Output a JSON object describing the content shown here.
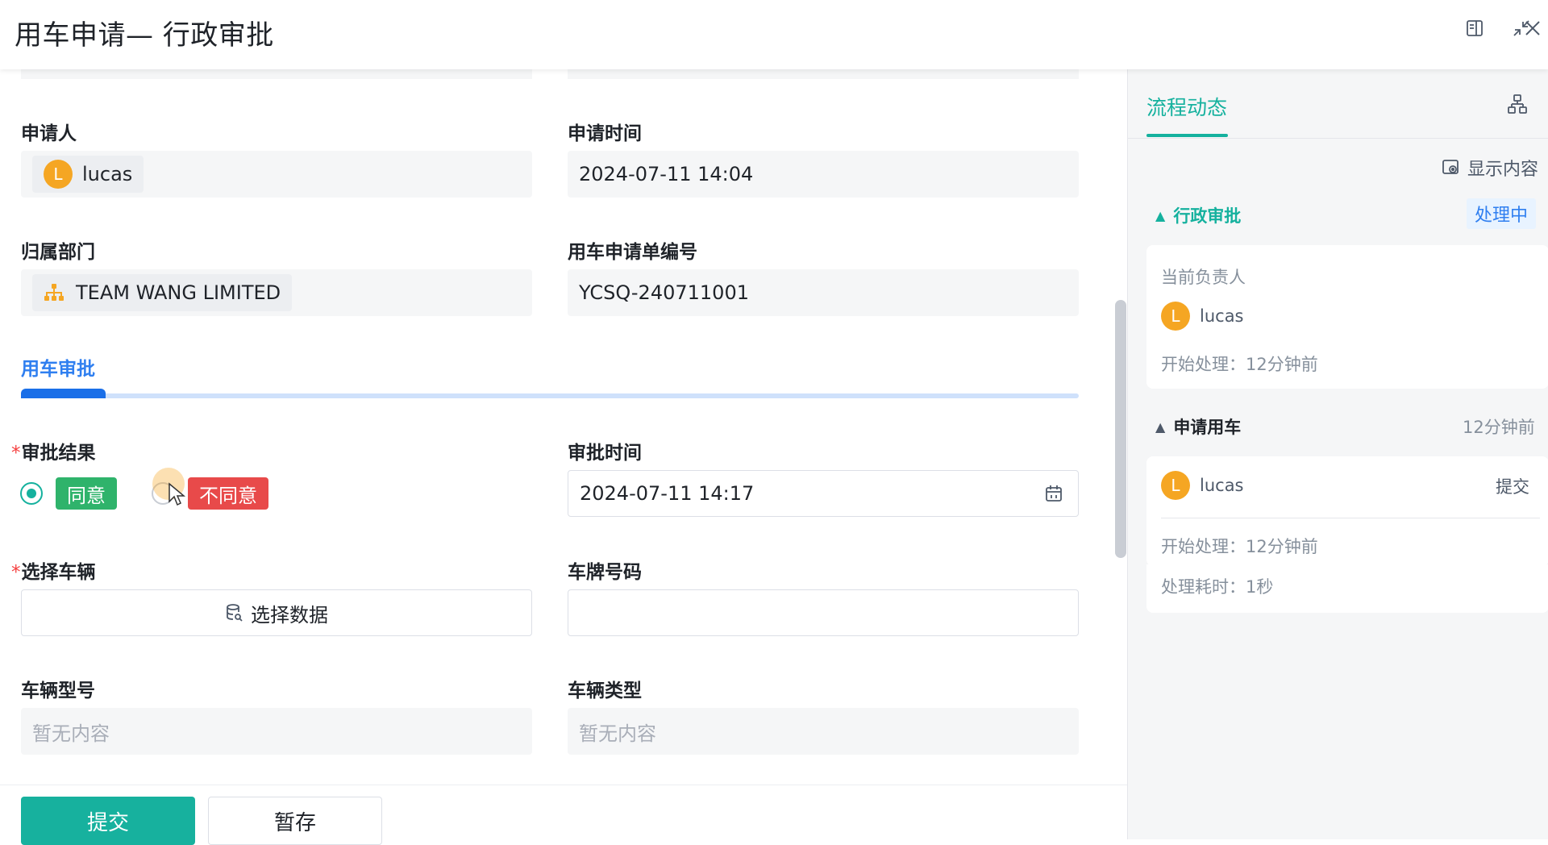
{
  "header": {
    "title": "用车申请— 行政审批",
    "icons": [
      "sidebar-toggle-icon",
      "collapse-icon",
      "close-icon"
    ]
  },
  "form": {
    "applicant": {
      "label": "申请人",
      "avatar_letter": "L",
      "name": "lucas"
    },
    "apply_time": {
      "label": "申请时间",
      "value": "2024-07-11 14:04"
    },
    "department": {
      "label": "归属部门",
      "value": "TEAM WANG LIMITED",
      "icon": "org-chart-icon"
    },
    "apply_no": {
      "label": "用车申请单编号",
      "value": "YCSQ-240711001"
    },
    "section": {
      "title": "用车审批",
      "progress": 0.08
    },
    "approval_result": {
      "label": "审批结果",
      "required_mark": "*",
      "options": [
        {
          "label": "同意",
          "color": "#2fb36b",
          "checked": true
        },
        {
          "label": "不同意",
          "color": "#e84a4a",
          "checked": false
        }
      ]
    },
    "approval_time": {
      "label": "审批时间",
      "value": "2024-07-11 14:17",
      "icon": "calendar-icon"
    },
    "select_vehicle": {
      "label": "选择车辆",
      "required_mark": "*",
      "button_label": "选择数据",
      "icon": "database-icon"
    },
    "plate_no": {
      "label": "车牌号码",
      "value": ""
    },
    "vehicle_model": {
      "label": "车辆型号",
      "placeholder": "暂无内容"
    },
    "vehicle_type": {
      "label": "车辆类型",
      "placeholder": "暂无内容"
    }
  },
  "footer": {
    "submit_label": "提交",
    "save_label": "暂存"
  },
  "sidebar": {
    "tab": "流程动态",
    "show_content": "显示内容",
    "nodes": [
      {
        "title": "行政审批",
        "status": "处理中",
        "owner_label": "当前负责人",
        "person": {
          "avatar_letter": "L",
          "name": "lucas"
        },
        "start_label": "开始处理：",
        "start_value": "12分钟前"
      },
      {
        "title": "申请用车",
        "time": "12分钟前",
        "person": {
          "avatar_letter": "L",
          "name": "lucas"
        },
        "action": "提交",
        "start_label": "开始处理：",
        "start_value": "12分钟前",
        "duration_label": "处理耗时：",
        "duration_value": "1秒"
      }
    ]
  },
  "colors": {
    "primary": "#17b19e",
    "link_blue": "#2f7ff0",
    "agree": "#2fb36b",
    "disagree": "#e84a4a",
    "avatar": "#f5a623"
  }
}
